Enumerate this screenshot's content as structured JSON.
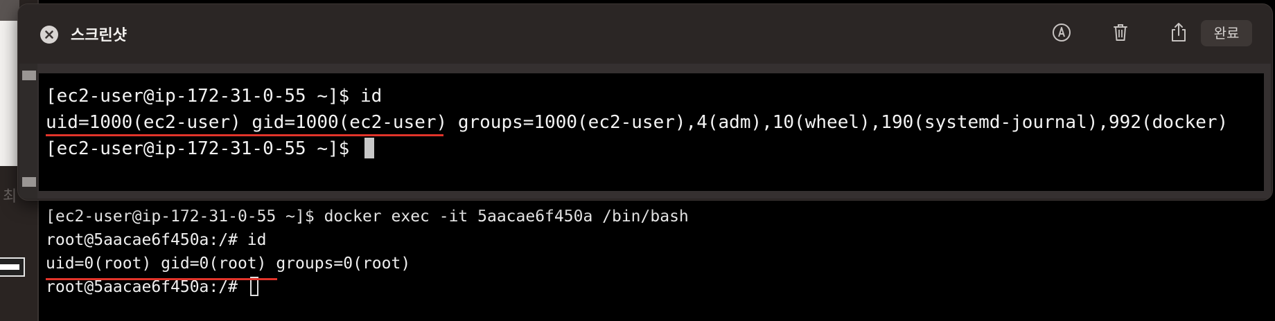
{
  "background": {
    "left_strip_label": "최",
    "terminal_lines": [
      "[ec2-user@ip-172-31-0-55 ~]$ docker exec -it 5aacae6f450a /bin/bash",
      "root@5aacae6f450a:/# id",
      "uid=0(root) gid=0(root) groups=0(root)",
      "root@5aacae6f450a:/# "
    ]
  },
  "preview": {
    "title": "스크린샷",
    "done_label": "완료",
    "toolbar_icons": [
      "markup-icon",
      "trash-icon",
      "share-icon"
    ],
    "terminal_lines": [
      "[ec2-user@ip-172-31-0-55 ~]$ id",
      "uid=1000(ec2-user) gid=1000(ec2-user) groups=1000(ec2-user),4(adm),10(wheel),190(systemd-journal),992(docker)",
      "[ec2-user@ip-172-31-0-55 ~]$ "
    ]
  },
  "colors": {
    "highlight_underline": "#e2342a",
    "window_bg": "#2b2625",
    "terminal_bg": "#000000",
    "terminal_text": "#f4f4f4"
  }
}
